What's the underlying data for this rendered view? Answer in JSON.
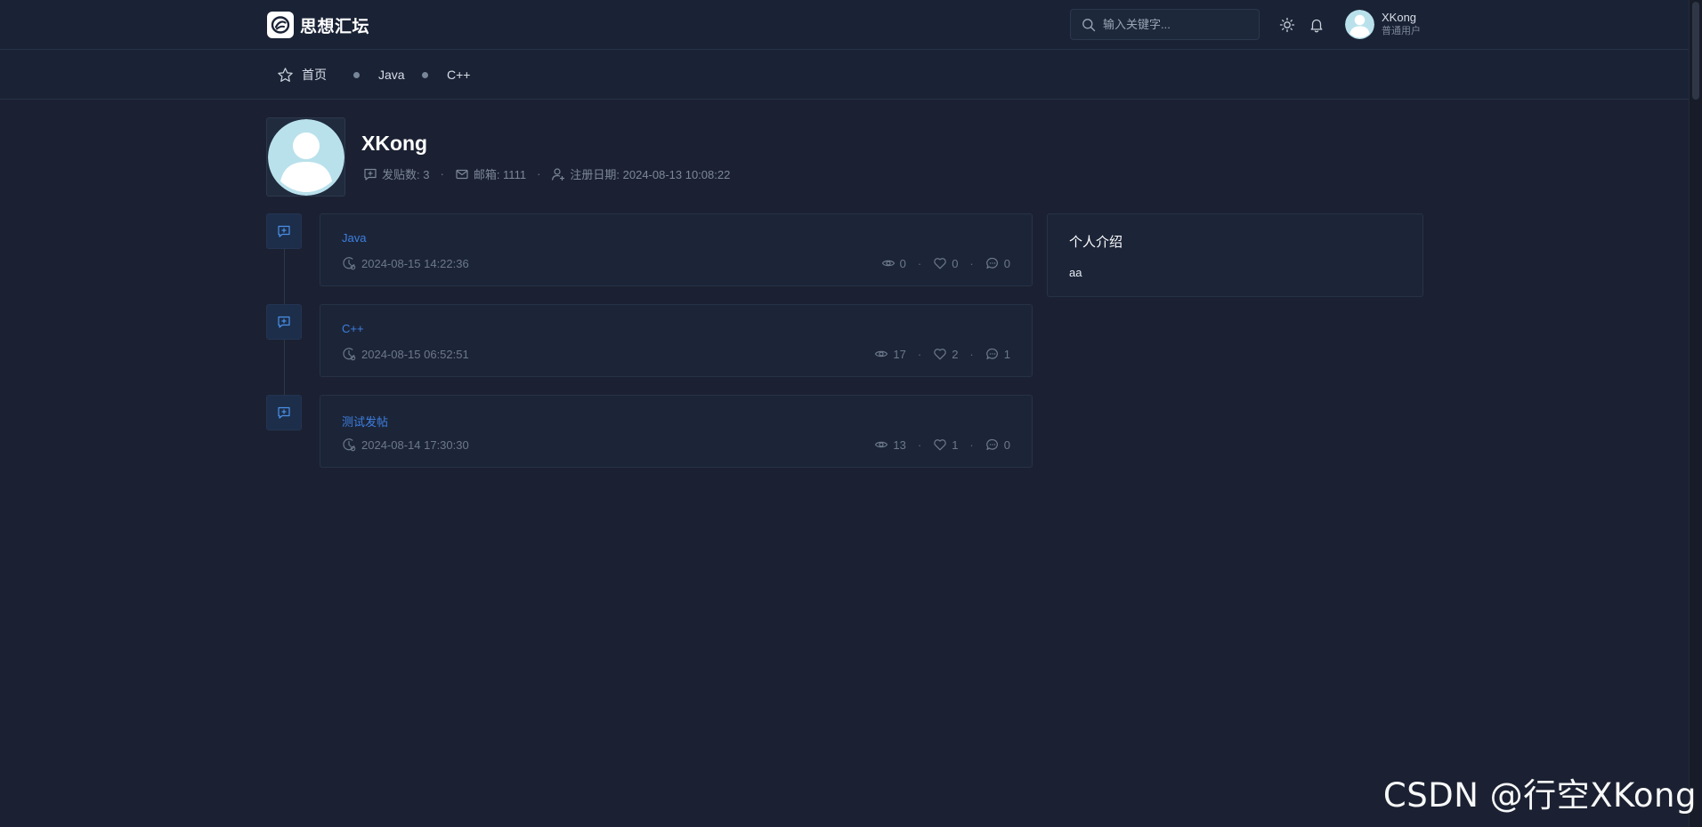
{
  "header": {
    "logo_text": "思想汇坛",
    "search_placeholder": "输入关键字...",
    "user": {
      "name": "XKong",
      "role": "普通用户"
    }
  },
  "nav": [
    {
      "label": "首页",
      "icon": "star-icon"
    },
    {
      "label": "Java",
      "icon": "dot-icon"
    },
    {
      "label": "C++",
      "icon": "dot-icon"
    }
  ],
  "profile": {
    "name": "XKong",
    "posts_label": "发贴数: 3",
    "email_label": "邮箱: 1111",
    "register_label": "注册日期: 2024-08-13 10:08:22"
  },
  "posts": [
    {
      "title": "Java",
      "date": "2024-08-15 14:22:36",
      "views": "0",
      "likes": "0",
      "comments": "0"
    },
    {
      "title": "C++",
      "date": "2024-08-15 06:52:51",
      "views": "17",
      "likes": "2",
      "comments": "1"
    },
    {
      "title": "测试发帖",
      "date": "2024-08-14 17:30:30",
      "views": "13",
      "likes": "1",
      "comments": "0"
    }
  ],
  "about": {
    "title": "个人介绍",
    "text": "aa"
  },
  "watermark": "CSDN @行空XKong",
  "colors": {
    "background": "#1b2132",
    "header": "#1a2335",
    "card": "#1c2538",
    "link": "#3d7fe0",
    "muted": "#7b8799"
  }
}
